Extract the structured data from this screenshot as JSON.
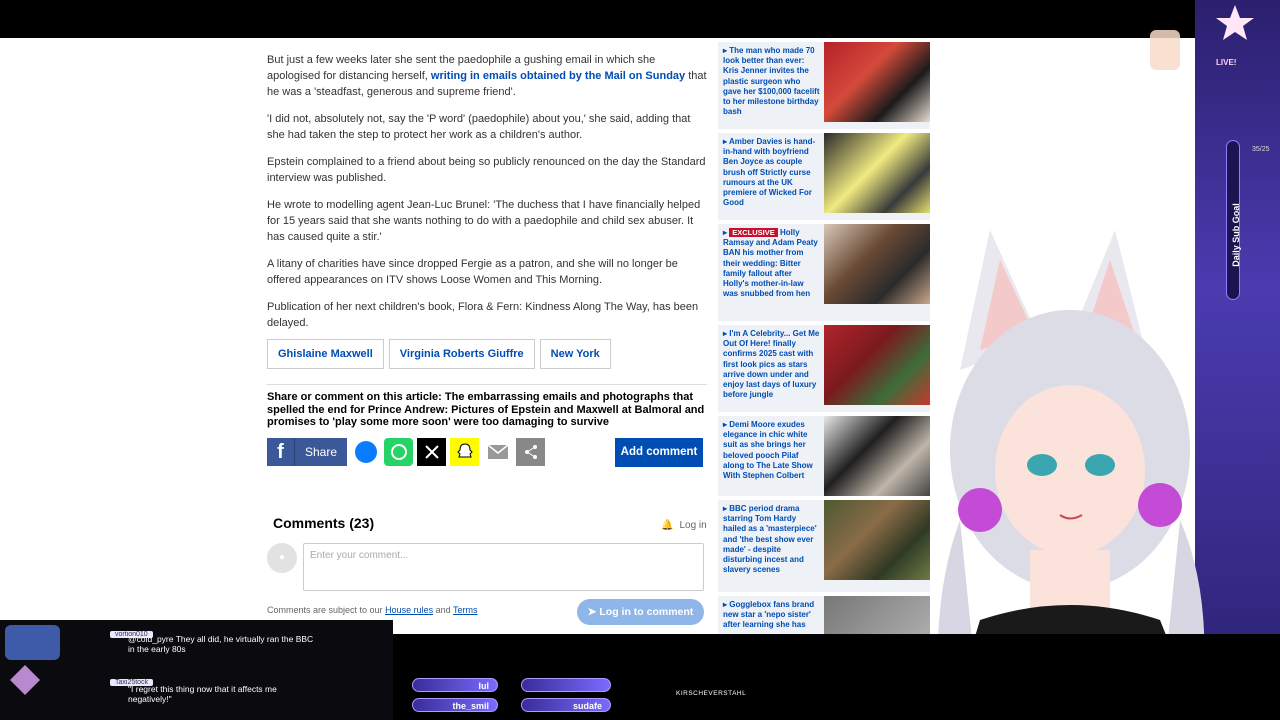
{
  "article": {
    "para1_text": "But just a few weeks later she sent the paedophile a gushing email in which she apologised for distancing herself, ",
    "para1_link": "writing in emails obtained by the Mail on Sunday",
    "para1_tail": " that he was a 'steadfast, generous and supreme friend'.",
    "para2": "'I did not, absolutely not, say the 'P word' (paedophile) about you,' she said, adding that she had taken the step to protect her work as a children's author.",
    "para3": "Epstein complained to a friend about being so publicly renounced on the day the Standard interview was published.",
    "para4": "He wrote to modelling agent Jean-Luc Brunel: 'The duchess that I have financially helped for 15 years said that she wants nothing to do with a paedophile and child sex abuser. It has caused quite a stir.'",
    "para5": "A litany of charities have since dropped Fergie as a patron, and she will no longer be offered appearances on ITV shows Loose Women and This Morning.",
    "para6": "Publication of her next children's book, Flora & Fern: Kindness Along The Way, has been delayed."
  },
  "tags": [
    "Ghislaine Maxwell",
    "Virginia Roberts Giuffre",
    "New York"
  ],
  "share": {
    "title": "Share or comment on this article: The embarrassing emails and photographs that spelled the end for Prince Andrew: Pictures of Epstein and Maxwell at Balmoral and promises to 'play some more soon' were too damaging to survive",
    "facebook_label": "Share",
    "add_comment_label": "Add comment"
  },
  "comments": {
    "title": "Comments (23)",
    "login_label": "Log in",
    "placeholder": "Enter your comment...",
    "notes_prefix": "Comments are subject to our ",
    "house_rules": "House rules",
    "and": " and ",
    "terms": "Terms",
    "login_to_comment": "Log in to comment"
  },
  "sidebar": [
    {
      "exclusive": "",
      "headline": "The man who made 70 look better than ever: Kris Jenner invites the plastic surgeon who gave her $100,000 facelift to her milestone birthday bash",
      "image_style": "img1"
    },
    {
      "exclusive": "",
      "headline": "Amber Davies is hand-in-hand with boyfriend Ben Joyce as couple brush off Strictly curse rumours at the UK premiere of Wicked For Good",
      "image_style": "img2"
    },
    {
      "exclusive": "EXCLUSIVE",
      "headline": " Holly Ramsay and Adam Peaty BAN his mother from their wedding: Bitter family fallout after Holly's mother-in-law was snubbed from hen",
      "image_style": "img3"
    },
    {
      "exclusive": "",
      "headline": "I'm A Celebrity... Get Me Out Of Here! finally confirms 2025 cast with first look pics as stars arrive down under and enjoy last days of luxury before jungle",
      "image_style": "img4"
    },
    {
      "exclusive": "",
      "headline": "Demi Moore exudes elegance in chic white suit as she brings her beloved pooch Pilaf along to The Late Show With Stephen Colbert",
      "image_style": "img5"
    },
    {
      "exclusive": "",
      "headline": "BBC period drama starring Tom Hardy hailed as a 'masterpiece' and 'the best show ever made' - despite disturbing incest and slavery scenes",
      "image_style": "img6"
    },
    {
      "exclusive": "",
      "headline": "Gogglebox fans brand new star a 'nepo sister' after learning she has",
      "image_style": "img7"
    }
  ],
  "overlay": {
    "live": "LIVE!",
    "goal_label": "Daily Sub Goal",
    "goal_count": "35/25",
    "chat": [
      {
        "user": "vortion010",
        "message": "@cold_pyre They all did, he virtually ran the BBC in the early 80s"
      },
      {
        "user": "Taxi25tock",
        "message": "\"I regret this thing now that it affects me negatively!\""
      }
    ],
    "names": [
      "lul",
      "the_smil",
      "sudafe"
    ],
    "follower": "KIRSCHEVERSTAHL"
  },
  "colors": {
    "link": "#004db3",
    "accent": "#004db3",
    "exclusive": "#c8102e",
    "facebook": "#3b5998"
  }
}
